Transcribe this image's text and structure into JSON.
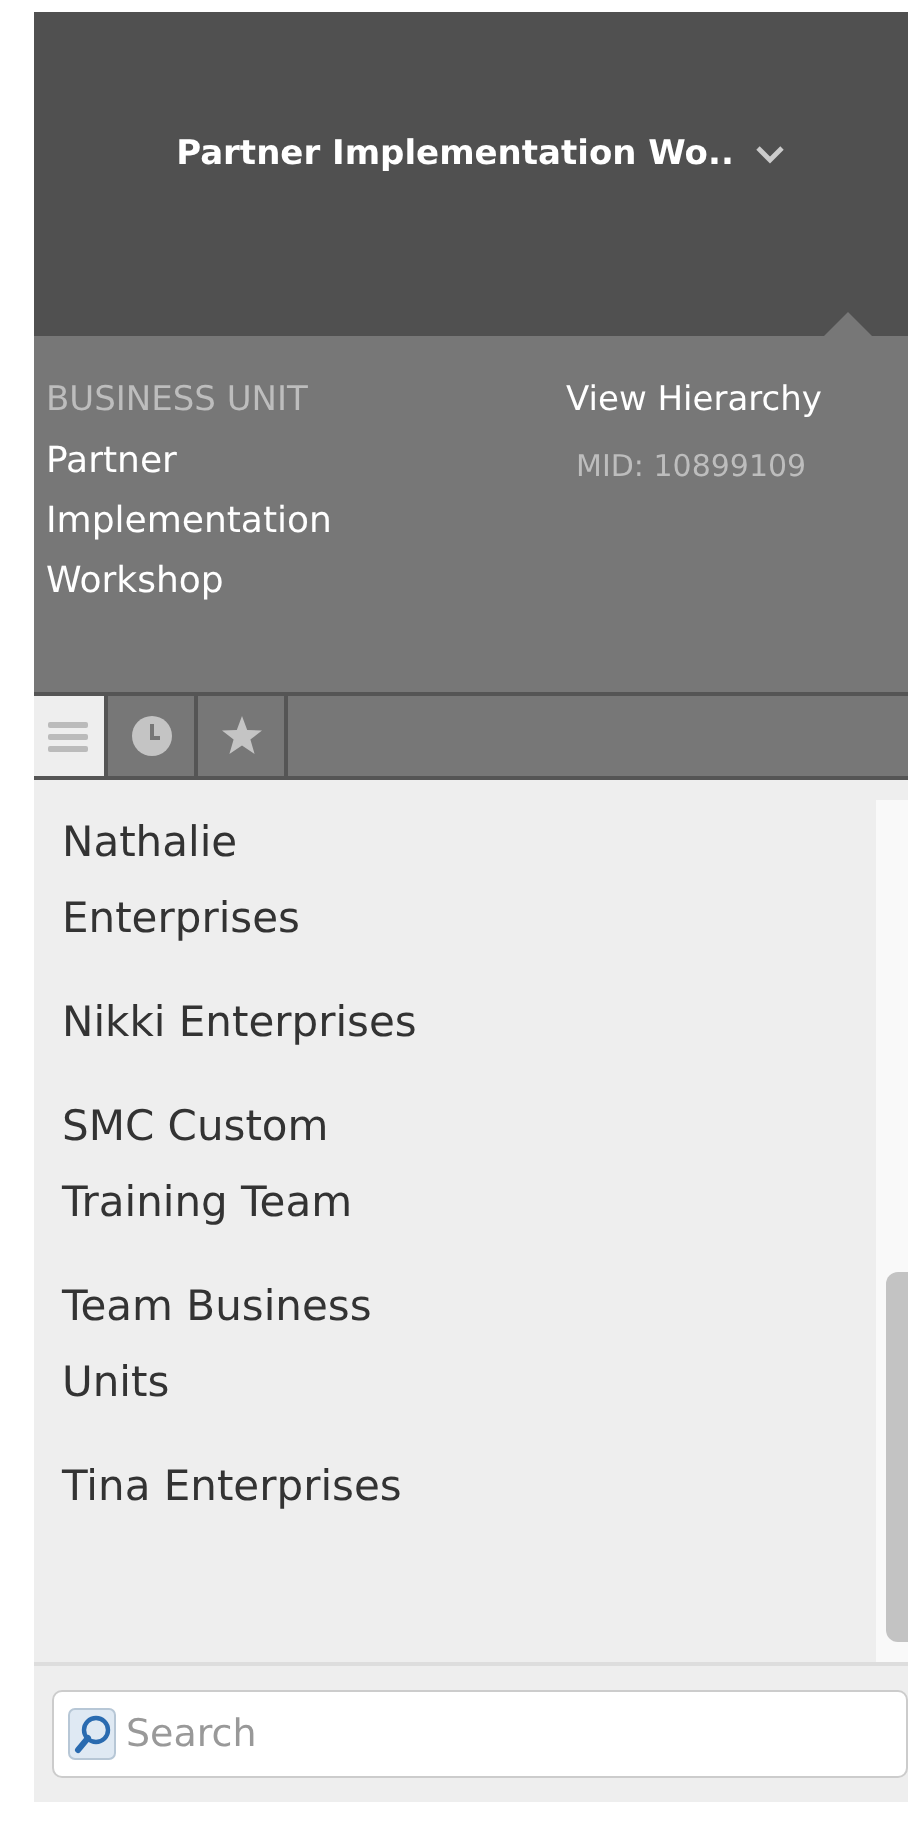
{
  "header": {
    "title": "Partner Implementation Wo.."
  },
  "unit": {
    "label": "BUSINESS UNIT",
    "name": "Partner Implementation Workshop",
    "link": "View Hierarchy",
    "mid": "MID: 10899109"
  },
  "tabs": [
    {
      "kind": "list",
      "selected": true
    },
    {
      "kind": "clock",
      "selected": false
    },
    {
      "kind": "star",
      "selected": false
    }
  ],
  "items": [
    {
      "label": "Nathalie Enterprises"
    },
    {
      "label": "Nikki Enterprises"
    },
    {
      "label": "SMC Custom Training Team"
    },
    {
      "label": "Team Business Units"
    },
    {
      "label": "Tina Enterprises"
    }
  ],
  "search": {
    "placeholder": "Search"
  }
}
